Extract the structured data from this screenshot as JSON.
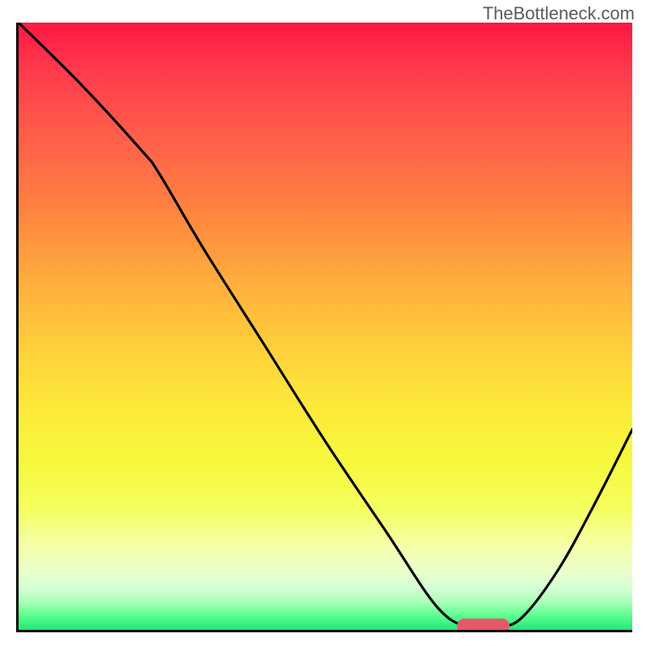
{
  "watermark": "TheBottleneck.com",
  "chart_data": {
    "type": "line",
    "title": "",
    "xlabel": "",
    "ylabel": "",
    "xlim": [
      0,
      100
    ],
    "ylim": [
      0,
      100
    ],
    "grid": false,
    "legend": false,
    "series": [
      {
        "name": "bottleneck-curve",
        "x": [
          0,
          10,
          20,
          23,
          30,
          40,
          50,
          60,
          68,
          73,
          78,
          82,
          88,
          94,
          100
        ],
        "y": [
          100,
          90,
          79,
          75,
          63,
          47,
          31,
          16,
          4,
          0.5,
          0.5,
          2,
          10,
          21,
          33
        ]
      }
    ],
    "marker": {
      "name": "optimal-range",
      "x_start": 71.5,
      "x_end": 80,
      "y": 0.6,
      "color": "#e45a6a"
    },
    "background_gradient": {
      "top": "#ff1744",
      "upper_mid": "#ffa03e",
      "mid": "#fde93a",
      "lower_mid": "#f5ffa8",
      "bottom": "#20e87a"
    }
  }
}
